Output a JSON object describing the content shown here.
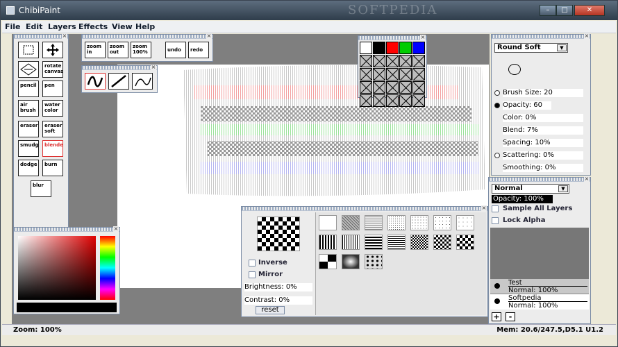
{
  "window": {
    "title": "ChibiPaint",
    "watermark": "SOFTPEDIA",
    "min": "–",
    "max": "□",
    "close": "✕"
  },
  "menu": [
    {
      "label": "File"
    },
    {
      "label": "Edit"
    },
    {
      "label": "Layers"
    },
    {
      "label": "Effects"
    },
    {
      "label": "View"
    },
    {
      "label": "Help"
    }
  ],
  "tools": {
    "rotate_canvas": "rotate canvas",
    "pencil": "pencil",
    "pen": "pen",
    "air_brush": "air brush",
    "water_color": "water color",
    "eraser": "eraser",
    "eraser_soft": "eraser soft",
    "smudge": "smudge",
    "blender": "blender",
    "dodge": "dodge",
    "burn": "burn",
    "blur": "blur"
  },
  "view_buttons": {
    "zoom_in": "zoom in",
    "zoom_out": "zoom out",
    "zoom_100": "zoom 100%",
    "undo": "undo",
    "redo": "redo"
  },
  "palette_colors": [
    "#ffffff",
    "#000000",
    "#ff0000",
    "#00cc00",
    "#0000ff"
  ],
  "brush": {
    "preset": "Round Soft",
    "brush_size": "Brush Size: 20",
    "opacity": "Opacity: 60",
    "color": "Color: 0%",
    "blend": "Blend: 7%",
    "spacing": "Spacing: 10%",
    "scattering": "Scattering: 0%",
    "smoothing": "Smoothing: 0%"
  },
  "layers": {
    "mode": "Normal",
    "opacity": "Opacity: 100%",
    "sample_all": "Sample All Layers",
    "lock_alpha": "Lock Alpha",
    "items": [
      {
        "name": "Test",
        "mode": "Normal: 100%"
      },
      {
        "name": "Softpedia",
        "mode": "Normal: 100%"
      }
    ],
    "add": "+",
    "remove": "-"
  },
  "texture": {
    "inverse": "Inverse",
    "mirror": "Mirror",
    "brightness": "Brightness: 0%",
    "contrast": "Contrast: 0%",
    "reset": "reset"
  },
  "status": {
    "zoom": "Zoom: 100%",
    "memory": "Mem: 20.6/247.5,D5.1 U1.2"
  }
}
